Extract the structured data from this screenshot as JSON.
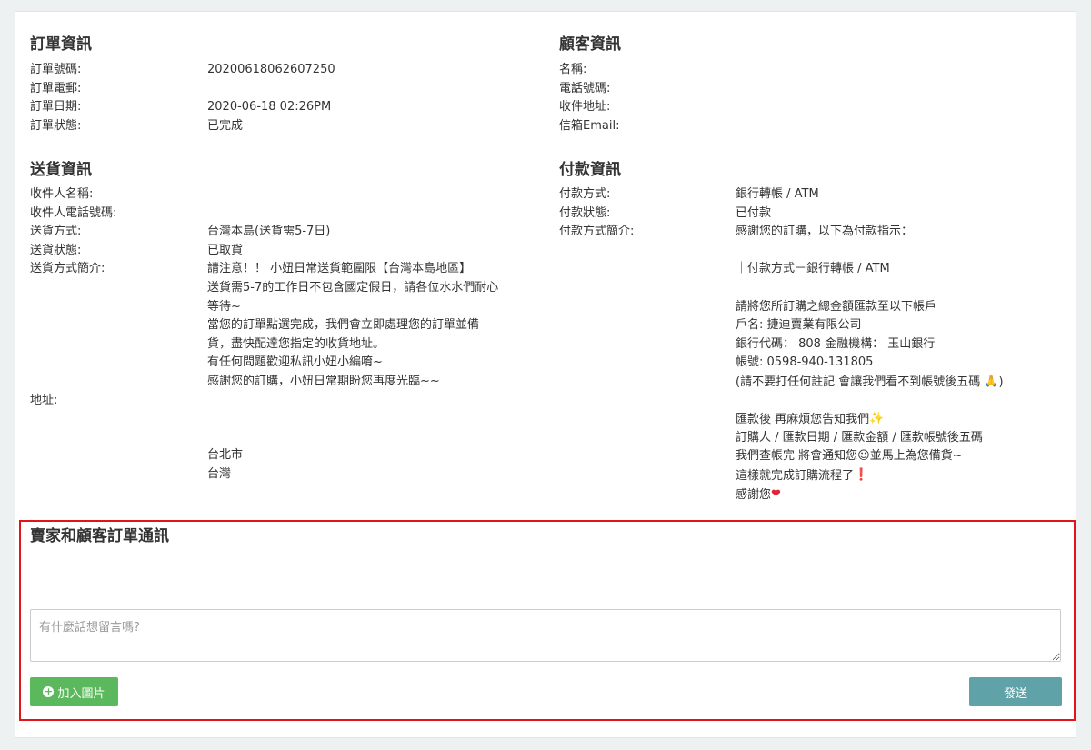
{
  "order": {
    "title": "訂單資訊",
    "rows": [
      {
        "label": "訂單號碼:",
        "value": "20200618062607250"
      },
      {
        "label": "訂單電郵:",
        "value": ""
      },
      {
        "label": "訂單日期:",
        "value": "2020-06-18 02:26PM"
      },
      {
        "label": "訂單狀態:",
        "value": "已完成"
      }
    ]
  },
  "customer": {
    "title": "顧客資訊",
    "rows": [
      {
        "label": "名稱:",
        "value": ""
      },
      {
        "label": "電話號碼:",
        "value": ""
      },
      {
        "label": "收件地址:",
        "value": ""
      },
      {
        "label": "信箱Email:",
        "value": ""
      }
    ]
  },
  "shipping": {
    "title": "送貨資訊",
    "rows": [
      {
        "label": "收件人名稱:",
        "value": ""
      },
      {
        "label": "收件人電話號碼:",
        "value": ""
      },
      {
        "label": "送貨方式:",
        "value": "台灣本島(送貨需5-7日)"
      },
      {
        "label": "送貨狀態:",
        "value": "已取貨"
      }
    ],
    "intro_label": "送貨方式簡介:",
    "intro_lines": [
      "請注意！！ 小妞日常送貨範圍限【台灣本島地區】",
      "送貨需5-7的工作日不包含國定假日，請各位水水們耐心",
      "等待~",
      "當您的訂單點選完成，我們會立即處理您的訂單並備",
      "貨，盡快配達您指定的收貨地址。",
      "有任何問題歡迎私訊小妞小編唷~",
      "感謝您的訂購，小妞日常期盼您再度光臨~~"
    ],
    "address_label": "地址:",
    "city": "台北市",
    "country": "台灣"
  },
  "payment": {
    "title": "付款資訊",
    "rows": [
      {
        "label": "付款方式:",
        "value": "銀行轉帳 / ATM"
      },
      {
        "label": "付款狀態:",
        "value": "已付款"
      }
    ],
    "intro_label": "付款方式簡介:",
    "intro_first": "感謝您的訂購，以下為付款指示：",
    "method_line": "｜付款方式－銀行轉帳 / ATM",
    "account_lines": [
      "請將您所訂購之總金額匯款至以下帳戶",
      "戶名: 捷迪賣業有限公司",
      "銀行代碼： 808 金融機構： 玉山銀行",
      "帳號: 0598-940-131805"
    ],
    "note_line": "(請不要打任何註記 會讓我們看不到帳號後五碼 ",
    "note_end": ")",
    "after_line": "匯款後 再麻煩您告知我們",
    "info_line": "訂購人 / 匯款日期 / 匯款金額 / 匯款帳號後五碼",
    "check_line_a": "我們查帳完 將會通知您",
    "check_line_b": "並馬上為您備貨~",
    "done_line": "這樣就完成訂購流程了",
    "thanks_line": "感謝您",
    "icons": [
      "pray-emoji",
      "sparkle-emoji",
      "smile-emoji",
      "exclamation-emoji",
      "heart-emoji"
    ]
  },
  "communication": {
    "title": "賣家和顧客訂單通訊",
    "placeholder": "有什麼話想留言嗎?",
    "add_image_label": "加入圖片",
    "send_label": "發送"
  },
  "colors": {
    "highlight_border": "#e0151b",
    "add_button": "#5cb85c",
    "send_button": "#5fa3a8"
  }
}
